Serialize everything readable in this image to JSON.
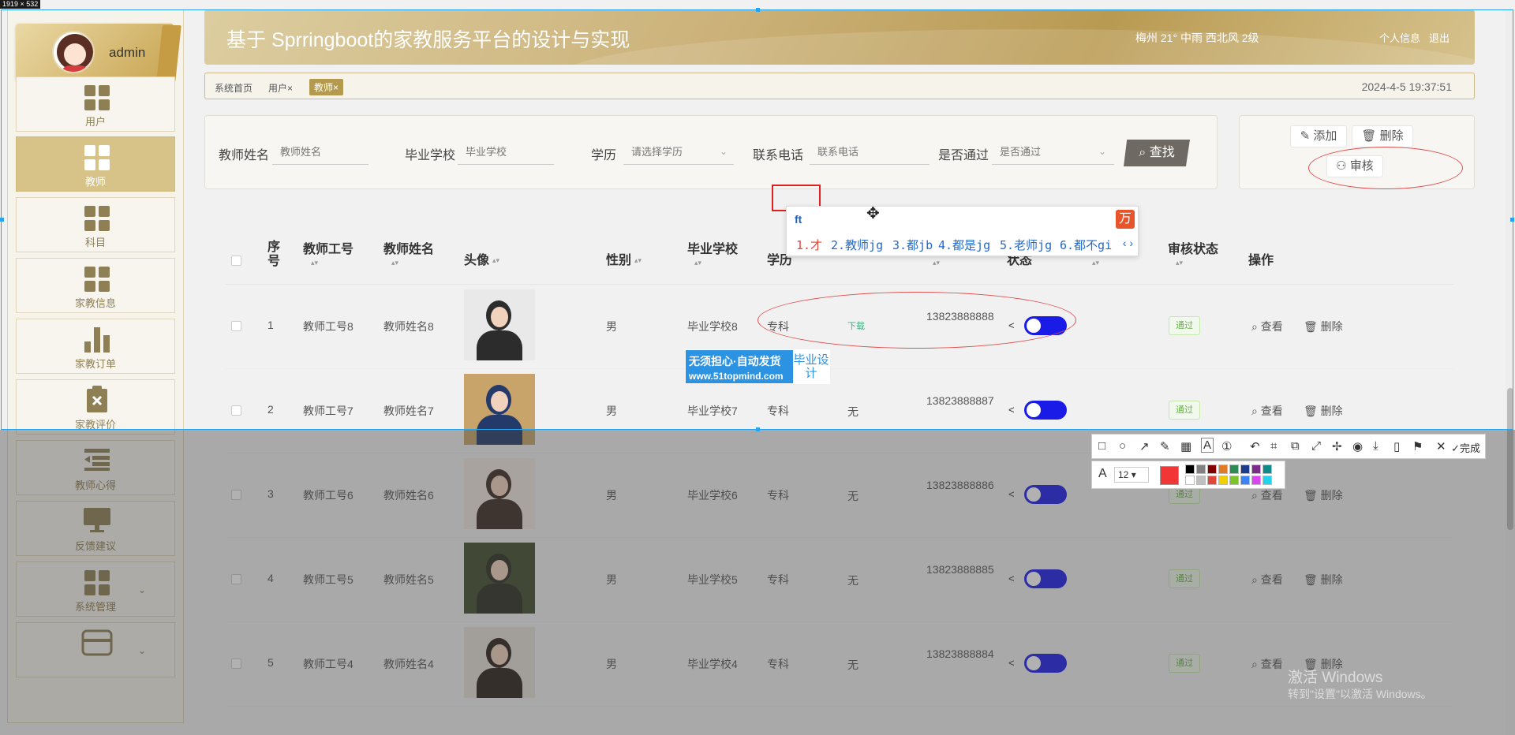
{
  "size_tag": "1919 × 532",
  "sidebar": {
    "username": "admin",
    "items": [
      {
        "label": "用户",
        "icon": "grid-icon"
      },
      {
        "label": "教师",
        "icon": "grid-icon"
      },
      {
        "label": "科目",
        "icon": "grid-icon"
      },
      {
        "label": "家教信息",
        "icon": "grid-icon"
      },
      {
        "label": "家教订单",
        "icon": "bar-chart-icon"
      },
      {
        "label": "家教评价",
        "icon": "clipboard-x-icon"
      },
      {
        "label": "教师心得",
        "icon": "list-icon"
      },
      {
        "label": "反馈建议",
        "icon": "monitor-icon"
      },
      {
        "label": "系统管理",
        "icon": "grid-icon"
      },
      {
        "label": "",
        "icon": "card-icon"
      }
    ]
  },
  "header": {
    "title": "基于 Sprringboot的家教服务平台的设计与实现",
    "weather": "梅州 21° 中雨 西北风 2级",
    "profile_link": "个人信息",
    "logout_link": "退出"
  },
  "breadcrumb": {
    "items": [
      "系统首页",
      "用户×",
      "教师×"
    ],
    "datetime": "2024-4-5 19:37:51"
  },
  "search": {
    "name_label": "教师姓名",
    "name_placeholder": "教师姓名",
    "school_label": "毕业学校",
    "school_placeholder": "毕业学校",
    "edu_label": "学历",
    "edu_placeholder": "请选择学历",
    "phone_label": "联系电话",
    "phone_placeholder": "联系电话",
    "pass_label": "是否通过",
    "pass_placeholder": "是否通过",
    "find_button": "查找"
  },
  "actions": {
    "add": "添加",
    "delete": "删除",
    "review": "审核"
  },
  "table": {
    "headers": {
      "index": "序号",
      "teacher_no": "教师工号",
      "teacher_name": "教师姓名",
      "photo": "头像",
      "gender": "性别",
      "school": "毕业学校",
      "education": "学历",
      "status": "状态",
      "review_status": "审核状态",
      "operation": "操作"
    },
    "rows": [
      {
        "index": "1",
        "teacher_no": "教师工号8",
        "teacher_name": "教师姓名8",
        "gender": "男",
        "school": "毕业学校8",
        "education": "专科",
        "file": "下载",
        "phone": "13823888888",
        "review": "通过"
      },
      {
        "index": "2",
        "teacher_no": "教师工号7",
        "teacher_name": "教师姓名7",
        "gender": "男",
        "school": "毕业学校7",
        "education": "专科",
        "file": "无",
        "phone": "13823888887",
        "review": "通过"
      },
      {
        "index": "3",
        "teacher_no": "教师工号6",
        "teacher_name": "教师姓名6",
        "gender": "男",
        "school": "毕业学校6",
        "education": "专科",
        "file": "无",
        "phone": "13823888886",
        "review": "通过"
      },
      {
        "index": "4",
        "teacher_no": "教师工号5",
        "teacher_name": "教师姓名5",
        "gender": "男",
        "school": "毕业学校5",
        "education": "专科",
        "file": "无",
        "phone": "13823888885",
        "review": "通过"
      },
      {
        "index": "5",
        "teacher_no": "教师工号4",
        "teacher_name": "教师姓名4",
        "gender": "男",
        "school": "毕业学校4",
        "education": "专科",
        "file": "无",
        "phone": "13823888884",
        "review": "通过"
      }
    ],
    "view_label": "查看",
    "delete_label": "删除"
  },
  "ime": {
    "input": "ft",
    "candidates": [
      "1.才",
      "2.教师jg",
      "3.都jb",
      "4.都是jg",
      "5.老师jg",
      "6.都不gi"
    ]
  },
  "watermark": {
    "line1": "无须担心·自动发货",
    "url": "www.51topmind.com",
    "badge": "毕业设计"
  },
  "capture_toolbar": {
    "done": "完成",
    "font_size": "12"
  },
  "windows_activation": {
    "line1": "激活 Windows",
    "line2": "转到\"设置\"以激活 Windows。"
  },
  "colors": {
    "accent": "#d7c388",
    "toggle": "#1b1be8",
    "brand_red": "#f23535"
  }
}
